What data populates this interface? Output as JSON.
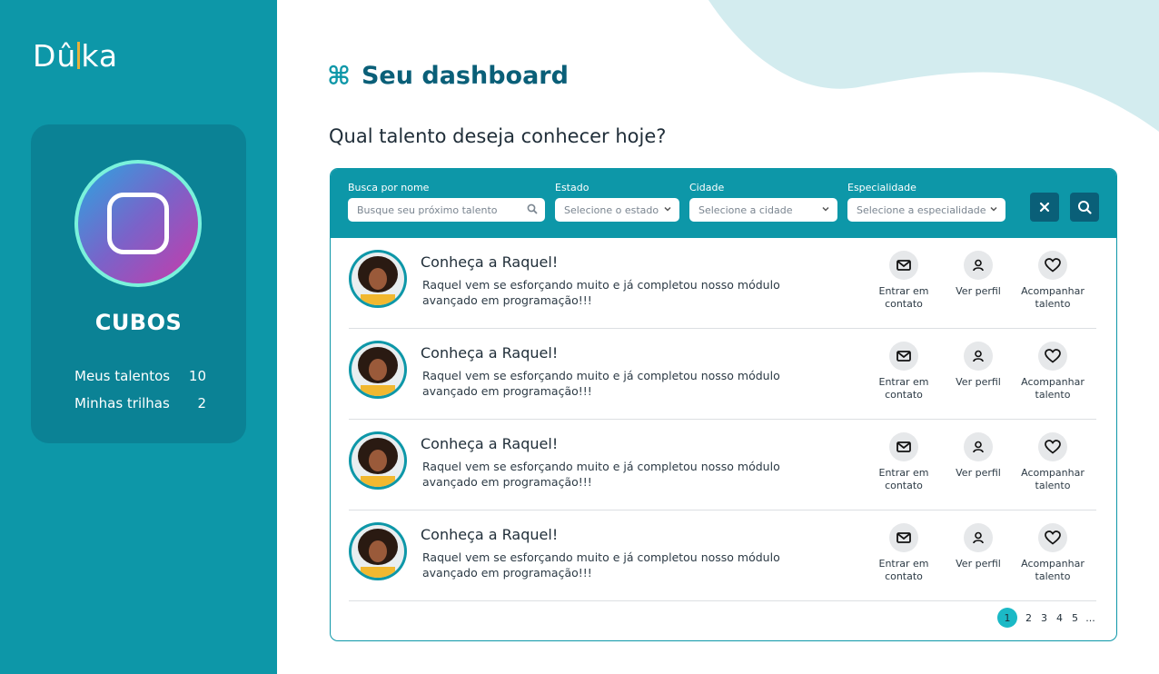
{
  "brand": {
    "logo_left": "Dû",
    "logo_right": "ka"
  },
  "profile": {
    "name": "CUBOS",
    "stats": [
      {
        "label": "Meus talentos",
        "value": "10"
      },
      {
        "label": "Minhas trilhas",
        "value": "2"
      }
    ]
  },
  "header": {
    "icon": "command-icon",
    "title": "Seu dashboard",
    "question": "Qual talento deseja conhecer hoje?"
  },
  "filters": {
    "name": {
      "label": "Busca por nome",
      "placeholder": "Busque seu próximo talento"
    },
    "state": {
      "label": "Estado",
      "placeholder": "Selecione o estado"
    },
    "city": {
      "label": "Cidade",
      "placeholder": "Selecione a cidade"
    },
    "specialty": {
      "label": "Especialidade",
      "placeholder": "Selecione a especialidade"
    }
  },
  "talents": [
    {
      "title": "Conheça a Raquel!",
      "description": "Raquel vem se esforçando muito e já completou nosso módulo avançado em programação!!!"
    },
    {
      "title": "Conheça a Raquel!",
      "description": "Raquel vem se esforçando muito e já completou nosso módulo avançado em programação!!!"
    },
    {
      "title": "Conheça a Raquel!",
      "description": "Raquel vem se esforçando muito e já completou nosso módulo avançado em programação!!!"
    },
    {
      "title": "Conheça a Raquel!",
      "description": "Raquel vem se esforçando muito e já completou nosso módulo avançado em programação!!!"
    }
  ],
  "actions": {
    "contact": {
      "line1": "Entrar em",
      "line2": "contato"
    },
    "profile": {
      "line1": "Ver perfil",
      "line2": ""
    },
    "follow": {
      "line1": "Acompanhar",
      "line2": "talento"
    }
  },
  "pagination": {
    "pages": [
      "1",
      "2",
      "3",
      "4",
      "5"
    ],
    "ellipsis": "...",
    "current": "1"
  },
  "colors": {
    "primary": "#0d97a8",
    "dark": "#0a5f78",
    "card": "#0b8295",
    "accent": "#1bb9c6"
  }
}
